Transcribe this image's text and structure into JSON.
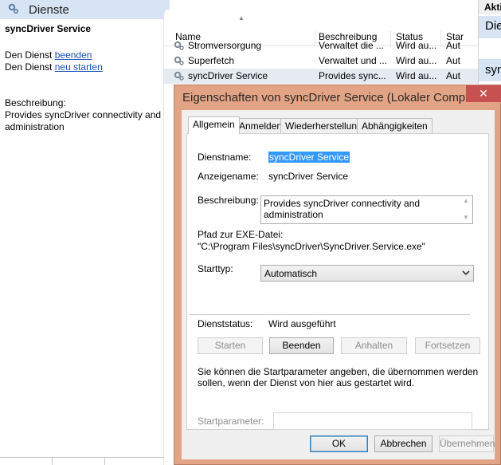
{
  "console": {
    "header_title": "Dienste",
    "service_name": "syncDriver Service",
    "stop_prefix": "Den Dienst",
    "stop_link": "beenden",
    "restart_prefix": "Den Dienst",
    "restart_link": "neu starten",
    "description_label": "Beschreibung:",
    "description_text": "Provides syncDriver connectivity and administration"
  },
  "list": {
    "columns": [
      "Name",
      "Beschreibung",
      "Status",
      "Star"
    ],
    "rows": [
      {
        "name": "Stromversorgung",
        "description": "Verwaltet die ...",
        "status": "Wird au...",
        "start": "Aut",
        "selected": false
      },
      {
        "name": "Superfetch",
        "description": "Verwaltet und ...",
        "status": "Wird au...",
        "start": "Aut",
        "selected": false
      },
      {
        "name": "syncDriver Service",
        "description": "Provides sync...",
        "status": "Wird au...",
        "start": "Aut",
        "selected": true
      }
    ]
  },
  "actions_pane": {
    "header": "Akti",
    "item1": "Die",
    "item2": "sync"
  },
  "dialog": {
    "title": "Eigenschaften von syncDriver Service (Lokaler Comput...",
    "close_symbol": "✕",
    "tabs": [
      "Allgemein",
      "Anmelden",
      "Wiederherstellung",
      "Abhängigkeiten"
    ],
    "active_tab": "Allgemein",
    "service_name_label": "Dienstname:",
    "service_name_value": "syncDriver Service",
    "display_name_label": "Anzeigename:",
    "display_name_value": "syncDriver Service",
    "description_label": "Beschreibung:",
    "description_value": "Provides syncDriver connectivity and administration",
    "exe_path_label": "Pfad zur EXE-Datei:",
    "exe_path_value": "\"C:\\Program Files\\syncDriver\\SyncDriver.Service.exe\"",
    "start_type_label": "Starttyp:",
    "start_type_value": "Automatisch",
    "status_label": "Dienststatus:",
    "status_value": "Wird ausgeführt",
    "control_buttons": {
      "start": "Starten",
      "stop": "Beenden",
      "pause": "Anhalten",
      "resume": "Fortsetzen"
    },
    "info_text": "Sie können die Startparameter angeben, die übernommen werden sollen, wenn der Dienst von hier aus gestartet wird.",
    "start_params_label": "Startparameter:",
    "start_params_value": "",
    "footer_buttons": {
      "ok": "OK",
      "cancel": "Abbrechen",
      "apply": "Übernehmen"
    }
  },
  "colors": {
    "dialog_frame": "#e3a385",
    "close_button": "#c75050",
    "selection": "#3399ff",
    "header_blue": "#d6e4f3",
    "link": "#1a4fb5"
  }
}
